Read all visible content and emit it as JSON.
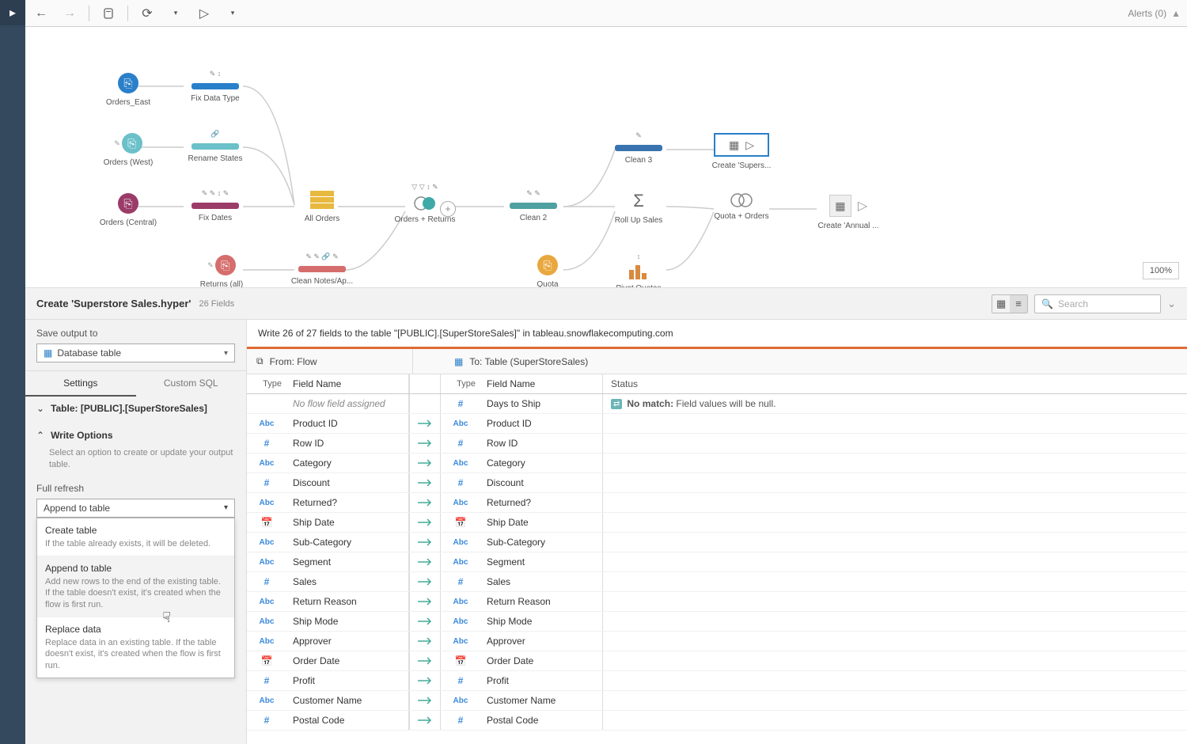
{
  "toolbar": {
    "alerts": "Alerts (0)"
  },
  "zoom": "100%",
  "detail": {
    "title": "Create 'Superstore Sales.hyper'",
    "fields": "26 Fields",
    "searchPlaceholder": "Search"
  },
  "config": {
    "saveLabel": "Save output to",
    "saveValue": "Database table",
    "tabs": {
      "settings": "Settings",
      "custom": "Custom SQL"
    },
    "tableLabel": "Table: [PUBLIC].[SuperStoreSales]",
    "writeOptions": "Write Options",
    "writeHint": "Select an option to create or update your output table.",
    "fullRefresh": "Full refresh",
    "append": "Append to table",
    "options": [
      {
        "title": "Create table",
        "desc": "If the table already exists, it will be deleted."
      },
      {
        "title": "Append to table",
        "desc": "Add new rows to the end of the existing table. If the table doesn't exist, it's created when the flow is first run."
      },
      {
        "title": "Replace data",
        "desc": "Replace data in an existing table. If the table doesn't exist, it's created when the flow is first run."
      }
    ]
  },
  "writeMsg": "Write 26 of 27 fields to the table \"[PUBLIC].[SuperStoreSales]\" in tableau.snowflakecomputing.com",
  "pair": {
    "from": "From: Flow",
    "to": "To: Table (SuperStoreSales)"
  },
  "tableHeader": {
    "type": "Type",
    "field": "Field Name",
    "status": "Status"
  },
  "nomatch": {
    "label": "No match:",
    "text": "Field values will be null."
  },
  "noflow": "No flow field assigned",
  "flowNodes": {
    "ordersEast": "Orders_East",
    "ordersWest": "Orders (West)",
    "ordersCentral": "Orders (Central)",
    "returnsAll": "Returns (all)",
    "fixDataType": "Fix Data Type",
    "renameStates": "Rename States",
    "fixDates": "Fix Dates",
    "cleanNotes": "Clean Notes/Ap...",
    "allOrders": "All Orders",
    "ordersReturns": "Orders + Returns",
    "clean2": "Clean 2",
    "clean3": "Clean 3",
    "quota": "Quota",
    "rollup": "Roll Up Sales",
    "pivot": "Pivot Quotas",
    "quotaOrders": "Quota + Orders",
    "createSupers": "Create 'Supers...",
    "createAnnual": "Create 'Annual ..."
  },
  "rows": [
    {
      "t": "num",
      "n": "Days to Ship",
      "noflow": true
    },
    {
      "t": "abc",
      "n": "Product ID"
    },
    {
      "t": "num",
      "n": "Row ID"
    },
    {
      "t": "abc",
      "n": "Category"
    },
    {
      "t": "num",
      "n": "Discount"
    },
    {
      "t": "abc",
      "n": "Returned?"
    },
    {
      "t": "date",
      "n": "Ship Date"
    },
    {
      "t": "abc",
      "n": "Sub-Category"
    },
    {
      "t": "abc",
      "n": "Segment"
    },
    {
      "t": "num",
      "n": "Sales"
    },
    {
      "t": "abc",
      "n": "Return Reason"
    },
    {
      "t": "abc",
      "n": "Ship Mode"
    },
    {
      "t": "abc",
      "n": "Approver"
    },
    {
      "t": "date",
      "n": "Order Date"
    },
    {
      "t": "num",
      "n": "Profit"
    },
    {
      "t": "abc",
      "n": "Customer Name"
    },
    {
      "t": "num",
      "n": "Postal Code"
    }
  ]
}
